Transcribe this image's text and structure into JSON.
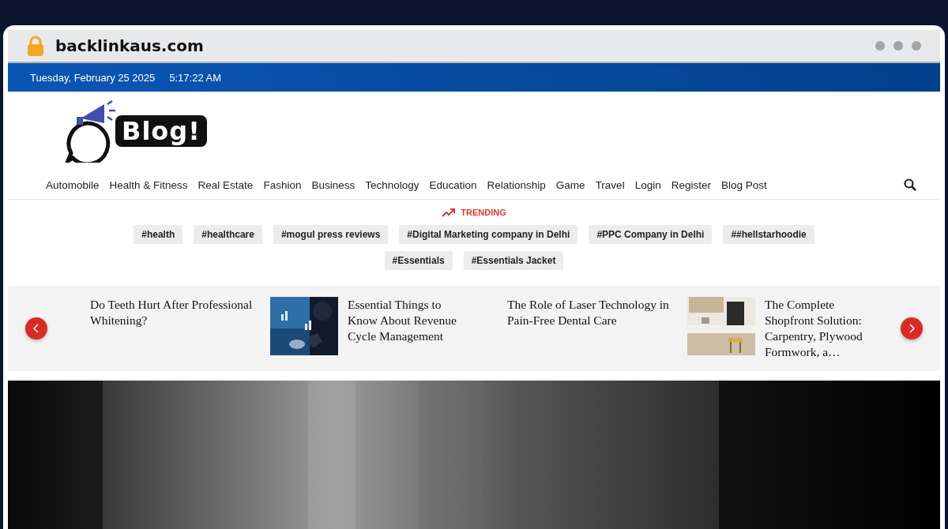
{
  "browser": {
    "url": "backlinkaus.com"
  },
  "top_bar": {
    "date": "Tuesday, February 25 2025",
    "time": "5:17:22 AM"
  },
  "logo": {
    "text": "Blog!"
  },
  "nav": [
    "Automobile",
    "Health & Fitness",
    "Real Estate",
    "Fashion",
    "Business",
    "Technology",
    "Education",
    "Relationship",
    "Game",
    "Travel",
    "Login",
    "Register",
    "Blog Post"
  ],
  "trending": {
    "label": "TRENDING",
    "tags": [
      "#health",
      "#healthcare",
      "#mogul press reviews",
      "#Digital Marketing company in Delhi",
      "#PPC Company in Delhi",
      "##hellstarhoodie",
      "#Essentials",
      "#Essentials Jacket"
    ]
  },
  "carousel": [
    {
      "kind": "text",
      "title": "Do Teeth Hurt After Professional Whitening?"
    },
    {
      "kind": "picture",
      "title": "Essential Things to Know About Revenue Cycle Management"
    },
    {
      "kind": "text",
      "title": "The Role of Laser Technology in Pain-Free Dental Care"
    },
    {
      "kind": "picture",
      "title": "The Complete Shopfront Solution: Carpentry, Plywood Formwork, a…"
    }
  ]
}
